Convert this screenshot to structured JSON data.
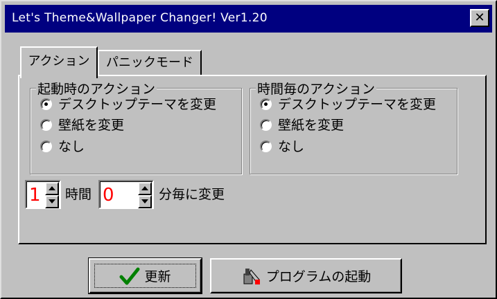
{
  "window": {
    "title": "Let's Theme&Wallpaper Changer! Ver1.20",
    "close_label": "✕"
  },
  "tabs": [
    {
      "label": "アクション",
      "active": true
    },
    {
      "label": "パニックモード",
      "active": false
    }
  ],
  "groups": {
    "startup": {
      "legend": "起動時のアクション",
      "options": [
        {
          "label": "デスクトップテーマを変更",
          "checked": true
        },
        {
          "label": "壁紙を変更",
          "checked": false
        },
        {
          "label": "なし",
          "checked": false
        }
      ]
    },
    "hourly": {
      "legend": "時間毎のアクション",
      "options": [
        {
          "label": "デスクトップテーマを変更",
          "checked": true
        },
        {
          "label": "壁紙を変更",
          "checked": false
        },
        {
          "label": "なし",
          "checked": false
        }
      ]
    }
  },
  "interval": {
    "hours_value": "1",
    "hours_label": "時間",
    "minutes_value": "0",
    "minutes_label": "分毎に変更"
  },
  "buttons": {
    "update_label": "更新",
    "update_icon": "checkmark-icon",
    "launch_label": "プログラムの起動",
    "launch_icon": "program-run-icon"
  },
  "colors": {
    "titlebar": "#000080",
    "face": "#c0c0c0",
    "spin_value": "#ff0000",
    "checkmark": "#008000"
  }
}
